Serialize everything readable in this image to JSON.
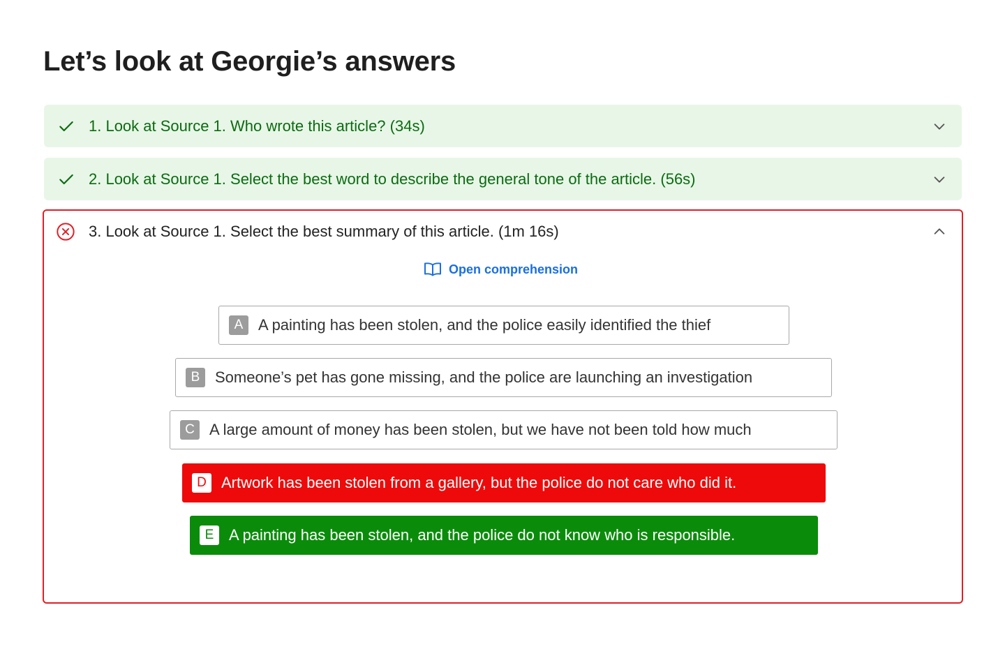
{
  "page": {
    "title": "Let’s look at Georgie’s answers"
  },
  "questions": [
    {
      "status": "correct",
      "status_icon": "check-icon",
      "title": "1. Look at Source 1. Who wrote this article? (34s)",
      "expanded": false
    },
    {
      "status": "correct",
      "status_icon": "check-icon",
      "title": "2. Look at Source 1. Select the best word to describe the general tone of the article. (56s)",
      "expanded": false
    },
    {
      "status": "incorrect",
      "status_icon": "x-circle-icon",
      "title": "3. Look at Source 1. Select the best summary of this article. (1m 16s)",
      "expanded": true,
      "link": {
        "icon": "book-open-icon",
        "label": "Open comprehension"
      },
      "options": [
        {
          "letter": "A",
          "text": "A painting has been stolen, and the police easily identified the thief",
          "state": "neutral"
        },
        {
          "letter": "B",
          "text": "Someone’s pet has gone missing, and the police are launching an investigation",
          "state": "neutral"
        },
        {
          "letter": "C",
          "text": "A large amount of money has been stolen, but we have not been told how much",
          "state": "neutral"
        },
        {
          "letter": "D",
          "text": "Artwork has been stolen from a gallery, but the police do not care who did it.",
          "state": "selected-incorrect"
        },
        {
          "letter": "E",
          "text": "A painting has been stolen, and the police do not know who is responsible.",
          "state": "correct-answer"
        }
      ]
    }
  ],
  "colors": {
    "correct_bg": "#e8f6e7",
    "correct_text": "#0b6b12",
    "incorrect_border": "#e01f26",
    "selected_wrong": "#ee0a0a",
    "correct_answer": "#0a8c0a",
    "link": "#1a6fe0"
  }
}
